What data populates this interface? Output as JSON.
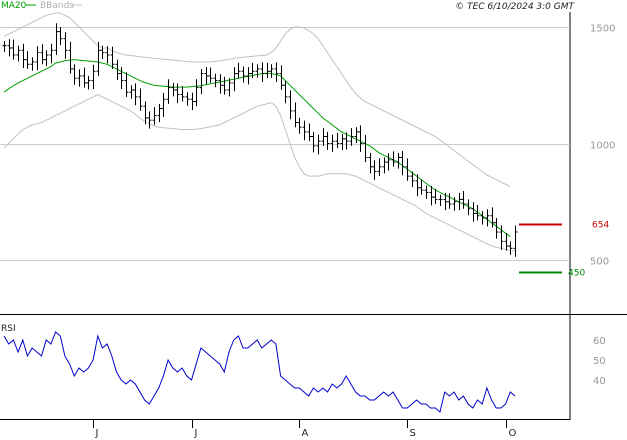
{
  "legend": {
    "ma_label": "MA20",
    "bb_label": "BBands",
    "rsi_label": "RSI"
  },
  "copyright": "© TEC 6/10/2024 3:0 GMT",
  "colors": {
    "ma": "#00a000",
    "bbands": "#c0c0c0",
    "price": "#000000",
    "rsi": "#0000cc",
    "resistance": "#cc0000",
    "support": "#008800",
    "axis_text": "#999999"
  },
  "chart_data": [
    {
      "type": "ohlc",
      "yscale": "linear",
      "ylim": [
        380,
        1620
      ],
      "grid": true,
      "yticks": [
        {
          "value": 1500,
          "label": "1500"
        },
        {
          "value": 1000,
          "label": "1000"
        },
        {
          "value": 500,
          "label": "500"
        }
      ],
      "xticks": [
        {
          "index": 19,
          "label": "J"
        },
        {
          "index": 40,
          "label": "J"
        },
        {
          "index": 63,
          "label": "A"
        },
        {
          "index": 86,
          "label": "S"
        },
        {
          "index": 107,
          "label": "O"
        }
      ],
      "n_bars": 110,
      "close": [
        1420,
        1410,
        1380,
        1400,
        1360,
        1340,
        1350,
        1390,
        1360,
        1380,
        1400,
        1480,
        1450,
        1400,
        1320,
        1280,
        1290,
        1260,
        1270,
        1310,
        1400,
        1390,
        1380,
        1340,
        1300,
        1270,
        1220,
        1230,
        1200,
        1160,
        1110,
        1100,
        1120,
        1150,
        1190,
        1240,
        1230,
        1210,
        1200,
        1190,
        1180,
        1240,
        1300,
        1290,
        1280,
        1270,
        1250,
        1230,
        1260,
        1300,
        1310,
        1290,
        1300,
        1310,
        1320,
        1300,
        1310,
        1320,
        1300,
        1250,
        1200,
        1140,
        1090,
        1070,
        1050,
        1030,
        990,
        1010,
        1030,
        1000,
        1010,
        1000,
        1020,
        1010,
        1030,
        1050,
        1000,
        940,
        900,
        880,
        900,
        920,
        930,
        920,
        940,
        900,
        860,
        840,
        810,
        800,
        790,
        770,
        760,
        760,
        750,
        740,
        750,
        760,
        740,
        720,
        700,
        690,
        680,
        690,
        660,
        620,
        580,
        560,
        550,
        620
      ],
      "ma_values": [
        1220,
        1235,
        1248,
        1260,
        1270,
        1280,
        1290,
        1300,
        1310,
        1320,
        1330,
        1345,
        1350,
        1355,
        1358,
        1360,
        1358,
        1356,
        1354,
        1352,
        1350,
        1345,
        1340,
        1330,
        1320,
        1310,
        1300,
        1290,
        1280,
        1270,
        1262,
        1256,
        1250,
        1248,
        1246,
        1244,
        1242,
        1242,
        1242,
        1242,
        1244,
        1246,
        1248,
        1252,
        1256,
        1260,
        1264,
        1268,
        1272,
        1276,
        1280,
        1284,
        1288,
        1292,
        1296,
        1300,
        1302,
        1300,
        1296,
        1290,
        1270,
        1250,
        1230,
        1210,
        1190,
        1170,
        1150,
        1130,
        1110,
        1095,
        1080,
        1065,
        1050,
        1040,
        1030,
        1020,
        1010,
        1000,
        990,
        975,
        960,
        950,
        940,
        930,
        920,
        905,
        890,
        875,
        860,
        845,
        830,
        815,
        800,
        790,
        780,
        770,
        760,
        750,
        740,
        730,
        720,
        705,
        690,
        675,
        660,
        645,
        630,
        615,
        600
      ],
      "bb_upper": [
        1460,
        1470,
        1480,
        1490,
        1500,
        1510,
        1520,
        1530,
        1540,
        1550,
        1555,
        1560,
        1560,
        1550,
        1540,
        1520,
        1500,
        1480,
        1460,
        1440,
        1420,
        1410,
        1410,
        1400,
        1390,
        1385,
        1380,
        1378,
        1375,
        1372,
        1370,
        1368,
        1366,
        1364,
        1362,
        1360,
        1358,
        1356,
        1354,
        1352,
        1350,
        1350,
        1350,
        1350,
        1350,
        1352,
        1355,
        1358,
        1362,
        1365,
        1368,
        1370,
        1372,
        1374,
        1376,
        1378,
        1380,
        1390,
        1410,
        1440,
        1470,
        1490,
        1500,
        1500,
        1495,
        1485,
        1470,
        1450,
        1420,
        1390,
        1360,
        1330,
        1300,
        1270,
        1240,
        1215,
        1195,
        1180,
        1170,
        1160,
        1150,
        1140,
        1130,
        1120,
        1110,
        1100,
        1090,
        1080,
        1070,
        1060,
        1050,
        1040,
        1030,
        1015,
        1000,
        985,
        970,
        955,
        940,
        925,
        910,
        895,
        880,
        865,
        855,
        845,
        835,
        825,
        815
      ],
      "bb_lower": [
        980,
        1000,
        1020,
        1040,
        1060,
        1070,
        1080,
        1085,
        1090,
        1100,
        1110,
        1120,
        1130,
        1140,
        1150,
        1160,
        1170,
        1180,
        1190,
        1200,
        1210,
        1200,
        1190,
        1180,
        1170,
        1160,
        1150,
        1140,
        1125,
        1110,
        1095,
        1085,
        1075,
        1070,
        1068,
        1066,
        1064,
        1062,
        1060,
        1060,
        1060,
        1062,
        1064,
        1068,
        1072,
        1076,
        1080,
        1090,
        1100,
        1110,
        1120,
        1130,
        1140,
        1150,
        1160,
        1165,
        1170,
        1175,
        1160,
        1120,
        1060,
        1000,
        940,
        900,
        870,
        860,
        860,
        860,
        865,
        870,
        870,
        870,
        870,
        870,
        865,
        860,
        850,
        840,
        830,
        820,
        810,
        800,
        790,
        780,
        770,
        760,
        750,
        740,
        730,
        715,
        700,
        690,
        680,
        670,
        660,
        650,
        640,
        630,
        620,
        610,
        600,
        590,
        580,
        570,
        560,
        555,
        550,
        545,
        540,
        538
      ],
      "levels": [
        {
          "value": 654,
          "label": "654",
          "kind": "resistance"
        },
        {
          "value": 450,
          "label": "450",
          "kind": "support"
        }
      ]
    },
    {
      "type": "line",
      "name": "RSI",
      "ylim": [
        0,
        100
      ],
      "yticks": [
        {
          "value": 60,
          "label": "60"
        },
        {
          "value": 50,
          "label": "50"
        },
        {
          "value": 40,
          "label": "40"
        }
      ],
      "values": [
        62,
        58,
        60,
        54,
        60,
        52,
        56,
        54,
        52,
        60,
        58,
        64,
        62,
        52,
        48,
        42,
        46,
        44,
        46,
        50,
        62,
        56,
        58,
        52,
        44,
        40,
        38,
        40,
        38,
        34,
        30,
        28,
        32,
        36,
        42,
        50,
        46,
        44,
        46,
        42,
        40,
        48,
        56,
        54,
        52,
        50,
        48,
        44,
        54,
        60,
        62,
        56,
        56,
        58,
        60,
        56,
        58,
        60,
        58,
        42,
        40,
        38,
        36,
        36,
        34,
        32,
        36,
        34,
        36,
        34,
        38,
        36,
        38,
        42,
        38,
        34,
        32,
        32,
        30,
        30,
        32,
        34,
        32,
        34,
        30,
        26,
        26,
        28,
        30,
        28,
        28,
        26,
        26,
        24,
        34,
        32,
        34,
        30,
        32,
        28,
        26,
        30,
        28,
        36,
        30,
        26,
        26,
        28,
        34,
        32
      ]
    }
  ]
}
